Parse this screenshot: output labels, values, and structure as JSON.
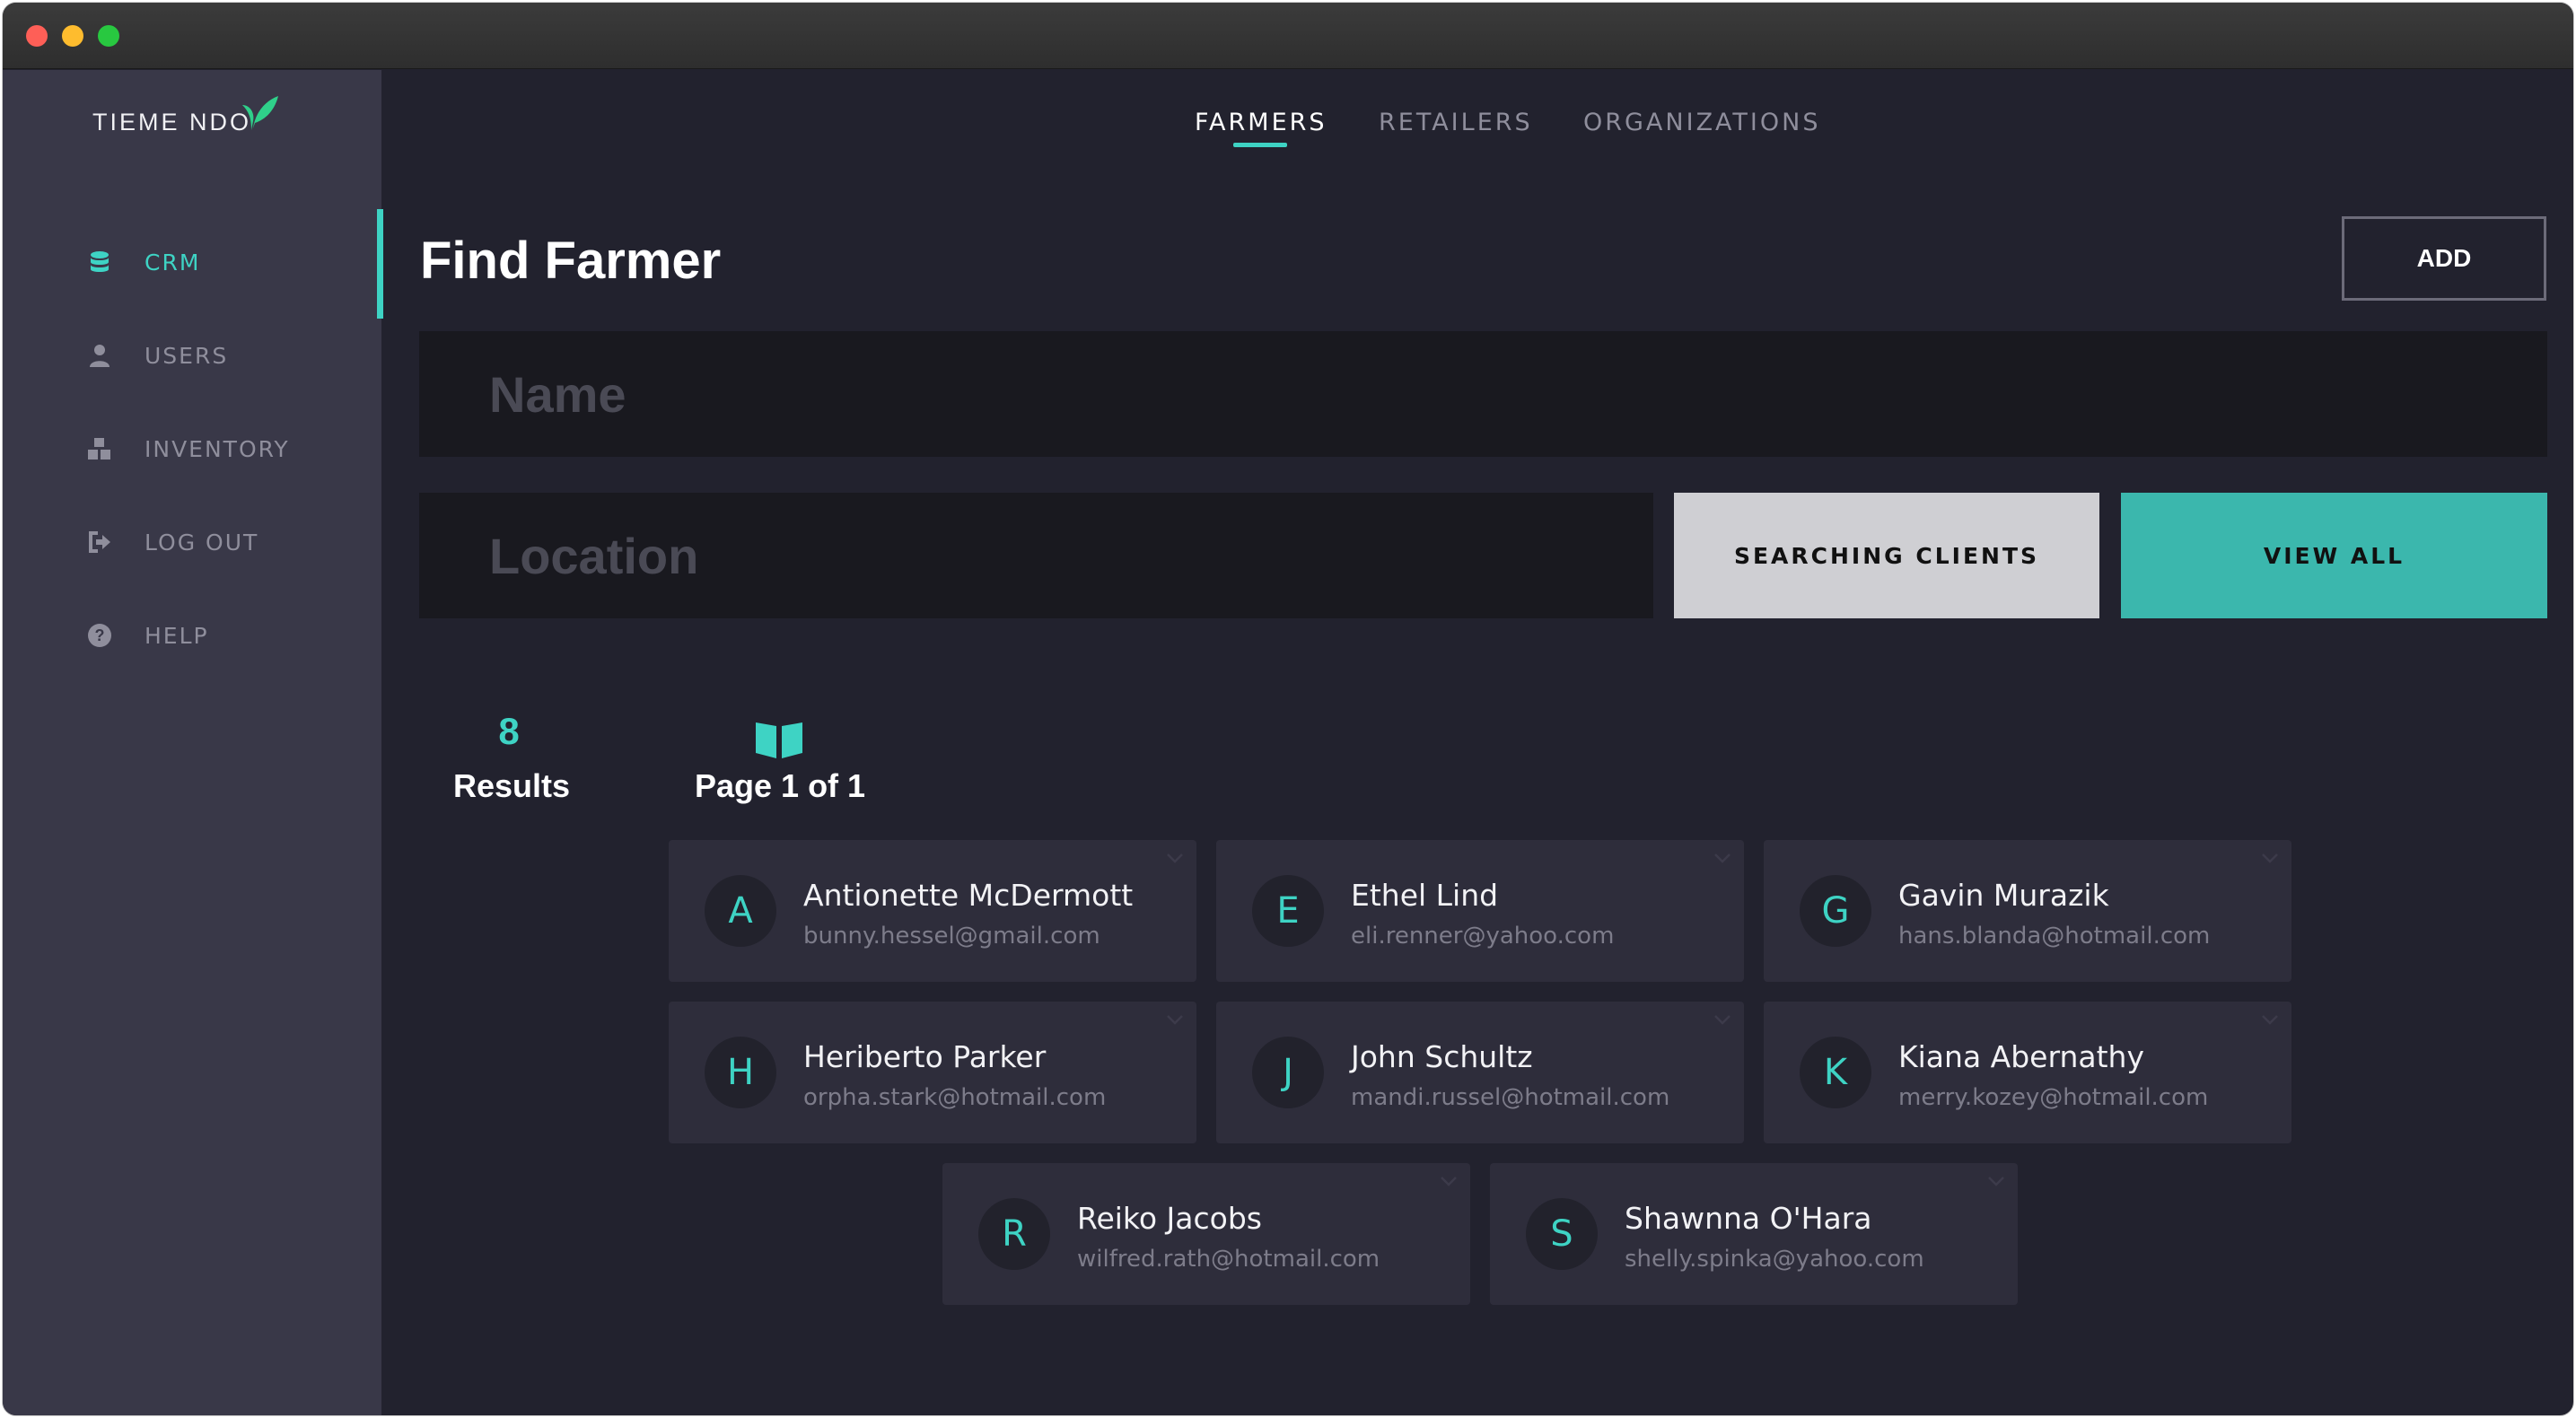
{
  "app": {
    "logo_text": "TIEME NDO",
    "accent_color": "#3ed3c4"
  },
  "sidebar": {
    "items": [
      {
        "label": "CRM",
        "icon": "database-icon",
        "active": true
      },
      {
        "label": "USERS",
        "icon": "user-icon",
        "active": false
      },
      {
        "label": "INVENTORY",
        "icon": "boxes-icon",
        "active": false
      },
      {
        "label": "LOG OUT",
        "icon": "logout-icon",
        "active": false
      },
      {
        "label": "HELP",
        "icon": "help-icon",
        "active": false
      }
    ]
  },
  "tabs": [
    {
      "label": "FARMERS",
      "active": true
    },
    {
      "label": "RETAILERS",
      "active": false
    },
    {
      "label": "ORGANIZATIONS",
      "active": false
    }
  ],
  "main": {
    "title": "Find Farmer",
    "add_label": "ADD",
    "name_placeholder": "Name",
    "location_placeholder": "Location",
    "search_label": "SEARCHING CLIENTS",
    "view_all_label": "VIEW ALL"
  },
  "stats": {
    "result_count": "8",
    "results_label": "Results",
    "page_label": "Page 1 of 1"
  },
  "clients": [
    {
      "initial": "A",
      "name": "Antionette McDermott",
      "email": "bunny.hessel@gmail.com"
    },
    {
      "initial": "E",
      "name": "Ethel Lind",
      "email": "eli.renner@yahoo.com"
    },
    {
      "initial": "G",
      "name": "Gavin Murazik",
      "email": "hans.blanda@hotmail.com"
    },
    {
      "initial": "H",
      "name": "Heriberto Parker",
      "email": "orpha.stark@hotmail.com"
    },
    {
      "initial": "J",
      "name": "John Schultz",
      "email": "mandi.russel@hotmail.com"
    },
    {
      "initial": "K",
      "name": "Kiana Abernathy",
      "email": "merry.kozey@hotmail.com"
    },
    {
      "initial": "R",
      "name": "Reiko Jacobs",
      "email": "wilfred.rath@hotmail.com"
    },
    {
      "initial": "S",
      "name": "Shawnna O'Hara",
      "email": "shelly.spinka@yahoo.com"
    }
  ]
}
